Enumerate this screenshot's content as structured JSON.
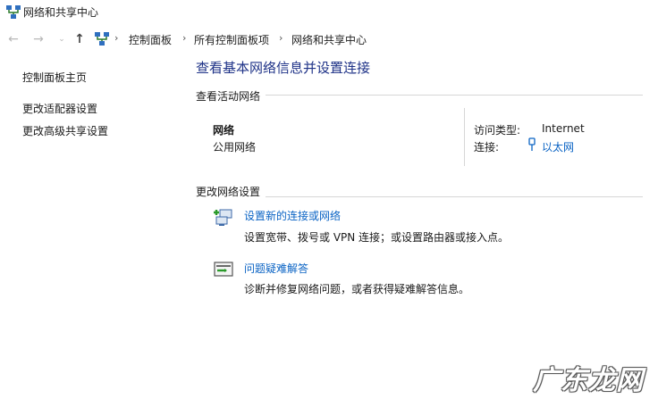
{
  "window": {
    "title": "网络和共享中心"
  },
  "breadcrumb": [
    "控制面板",
    "所有控制面板项",
    "网络和共享中心"
  ],
  "sidebar": {
    "items": [
      {
        "label": "控制面板主页"
      },
      {
        "label": "更改适配器设置"
      },
      {
        "label": "更改高级共享设置"
      }
    ]
  },
  "main": {
    "title": "查看基本网络信息并设置连接",
    "active_networks": {
      "section_label": "查看活动网络",
      "network_name": "网络",
      "network_type": "公用网络",
      "access_type_label": "访问类型:",
      "access_type_value": "Internet",
      "connection_label": "连接:",
      "connection_value": "以太网"
    },
    "change_settings": {
      "section_label": "更改网络设置",
      "tasks": [
        {
          "title": "设置新的连接或网络",
          "description": "设置宽带、拨号或 VPN 连接；或设置路由器或接入点。",
          "icon": "new-connection-icon"
        },
        {
          "title": "问题疑难解答",
          "description": "诊断并修复网络问题，或者获得疑难解答信息。",
          "icon": "troubleshoot-icon"
        }
      ]
    }
  },
  "watermark": {
    "text": "广东龙网"
  }
}
